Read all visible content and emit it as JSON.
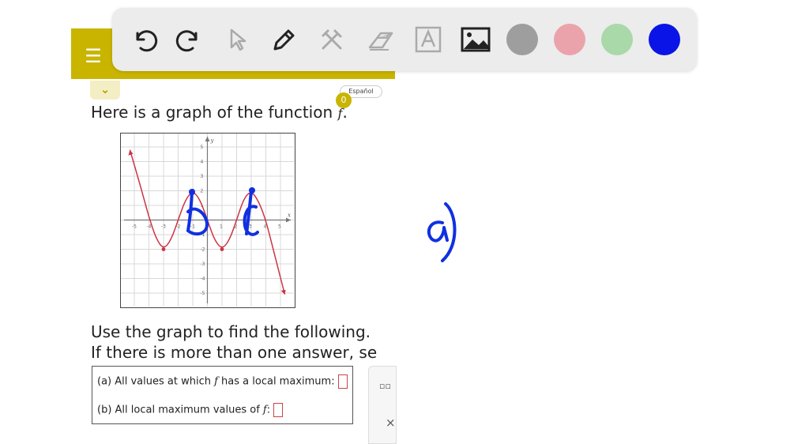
{
  "app": {
    "menu_icon": "hamburger-menu-icon",
    "collapse_icon": "chevron-down-icon",
    "language_label": "Español",
    "notification_count": "0",
    "accent_color": "#c9b400"
  },
  "toolbar": {
    "tools": [
      "undo-icon",
      "redo-icon",
      "pointer-icon",
      "pen-icon",
      "tools-icon",
      "eraser-icon",
      "text-icon",
      "image-icon"
    ],
    "colors": [
      "#9e9e9e",
      "#eba3ab",
      "#a9d8a9",
      "#0a14e6"
    ]
  },
  "question": {
    "prefix": "Here is a graph of the function ",
    "func": "f",
    "suffix": ".",
    "line1": "Use the graph to find the following.",
    "line2": "If there is more than one answer, se"
  },
  "graph": {
    "y_label": "y",
    "x_label": "x",
    "x_ticks": [
      "-5",
      "-4",
      "-3",
      "-2",
      "-1",
      "1",
      "2",
      "3",
      "4",
      "5"
    ],
    "y_ticks": [
      "5",
      "4",
      "3",
      "2",
      "1",
      "-1",
      "-2",
      "-3",
      "-4",
      "-5"
    ],
    "curve_color": "#cc3344"
  },
  "answers": {
    "a_prefix": "(a) All values at which ",
    "a_func": "f",
    "a_suffix": " has a local maximum:",
    "b_prefix": "(b) All local maximum values of ",
    "b_func": "f",
    "b_suffix": ":"
  },
  "side_panel": {
    "icon": "fraction-icon",
    "close_label": "×"
  },
  "annotations": {
    "ink_color": "#1030e0",
    "handwritten_label": "a)"
  }
}
